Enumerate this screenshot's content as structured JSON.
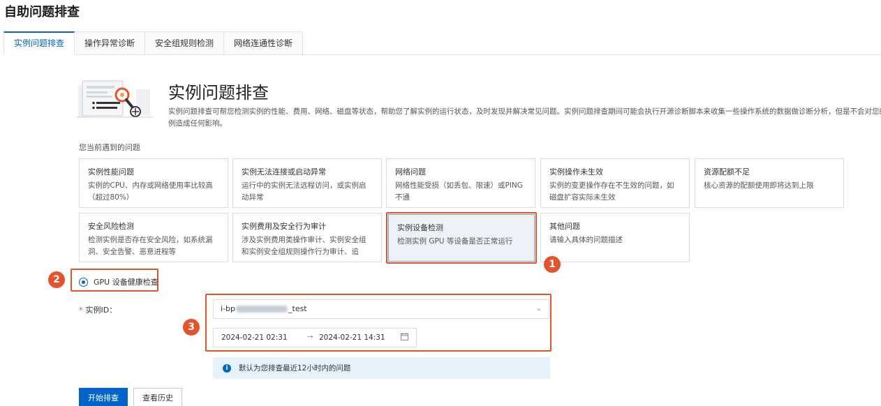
{
  "page_title": "自助问题排查",
  "tabs": [
    {
      "label": "实例问题排查",
      "active": true
    },
    {
      "label": "操作异常诊断"
    },
    {
      "label": "安全组规则检测"
    },
    {
      "label": "网络连通性诊断"
    }
  ],
  "hero": {
    "title": "实例问题排查",
    "description_line1": "实例问题排查可帮您检测实例的性能、费用、网络、磁盘等状态，帮助您了解实例的运行状态，及时发现并解决常见问题。实例问题排查期间可能会执行开源诊断脚本来收集一些操作系统的数据做诊断分析，但是不会对您的实",
    "description_line2": "例造成任何影响。"
  },
  "problems_label": "您当前遇到的问题",
  "cards": [
    {
      "title": "实例性能问题",
      "desc": "实例的CPU、内存或网络使用率比较高（超过80%）"
    },
    {
      "title": "实例无法连接或启动异常",
      "desc": "运行中的实例无法远程访问，或实例启动异常"
    },
    {
      "title": "网络问题",
      "desc": "网络性能受损（如丢包、限速）或PING不通"
    },
    {
      "title": "实例操作未生效",
      "desc": "实例的变更操作存在不生效的问题，如磁盘扩容实际未生效"
    },
    {
      "title": "资源配额不足",
      "desc": "核心资源的配额使用即将达到上限"
    },
    {
      "title": "安全风险检测",
      "desc": "检测实例是否存在安全风险，如系统漏洞、安全告警、恶意进程等"
    },
    {
      "title": "实例费用及安全行为审计",
      "desc": "涉及实例费用类操作审计、实例安全组和实例安全组规则操作行为审计、追溯..."
    },
    {
      "title": "实例设备检测",
      "desc": "检测实例 GPU 等设备是否正常运行",
      "selected": true
    },
    {
      "title": "其他问题",
      "desc": "请输入具体的问题描述"
    }
  ],
  "markers": {
    "one": "1",
    "two": "2",
    "three": "3"
  },
  "radio_option": "GPU 设备健康检查",
  "instance_field": {
    "required_mark": "*",
    "label": "实例ID：",
    "value_prefix": "i-bp",
    "value_suffix": "_test"
  },
  "date_range": {
    "start": "2024-02-21 02:31",
    "arrow": "→",
    "end": "2024-02-21 14:31"
  },
  "info_text": "默认为您排查最近12小时内的问题",
  "buttons": {
    "start": "开始排查",
    "history": "查看历史"
  },
  "colors": {
    "primary": "#0064c8",
    "highlight": "#e4542c",
    "info_bg": "#e6f2fb"
  },
  "icons": [
    "chevron-down-icon",
    "calendar-icon",
    "info-icon",
    "diagnosis-illustration"
  ]
}
